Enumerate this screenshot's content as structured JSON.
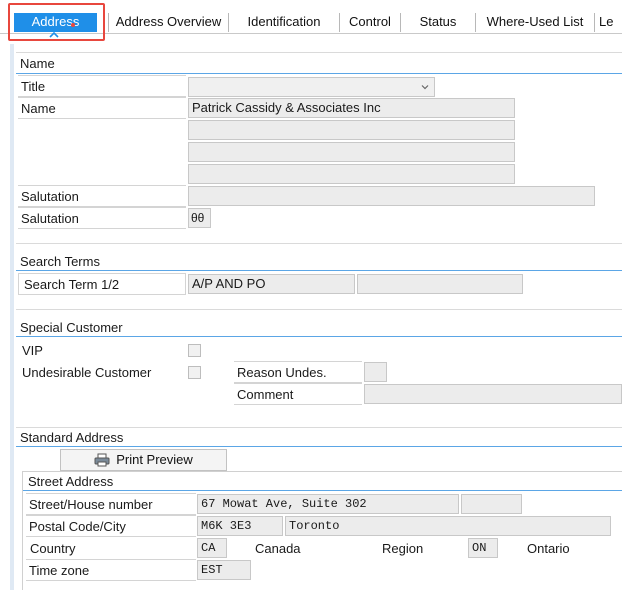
{
  "tabs": [
    {
      "label": "Address",
      "active": true
    },
    {
      "label": "Address Overview"
    },
    {
      "label": "Identification"
    },
    {
      "label": "Control"
    },
    {
      "label": "Status"
    },
    {
      "label": "Where-Used List"
    },
    {
      "label": "Le"
    }
  ],
  "name_section": {
    "title": "Name",
    "title_label": "Title",
    "title_value": "",
    "name_label": "Name",
    "name_value": "Patrick Cassidy & Associates Inc",
    "name2_value": "",
    "name3_value": "",
    "name4_value": "",
    "salutation_label": "Salutation",
    "salutation_value": "",
    "salutation2_label": "Salutation",
    "salutation2_value": "θθ"
  },
  "search_section": {
    "title": "Search Terms",
    "label": "Search Term 1/2",
    "term1": "A/P AND PO",
    "term2": ""
  },
  "special_section": {
    "title": "Special Customer",
    "vip_label": "VIP",
    "undesirable_label": "Undesirable Customer",
    "reason_label": "Reason Undes.",
    "reason_value": "",
    "comment_label": "Comment",
    "comment_value": ""
  },
  "address_section": {
    "title": "Standard Address",
    "print_preview": "Print Preview",
    "street_title": "Street Address",
    "street_label": "Street/House number",
    "street_value": "67 Mowat Ave, Suite 302",
    "house_value": "",
    "postal_label": "Postal Code/City",
    "postal_value": "M6K 3E3",
    "city_value": "Toronto",
    "country_label": "Country",
    "country_code": "CA",
    "country_name": "Canada",
    "region_label": "Region",
    "region_code": "ON",
    "region_name": "Ontario",
    "timezone_label": "Time zone",
    "timezone_value": "EST"
  },
  "colors": {
    "active_tab": "#1f8fe8",
    "highlight": "#e8473e",
    "section_line": "#5ba6e6"
  }
}
